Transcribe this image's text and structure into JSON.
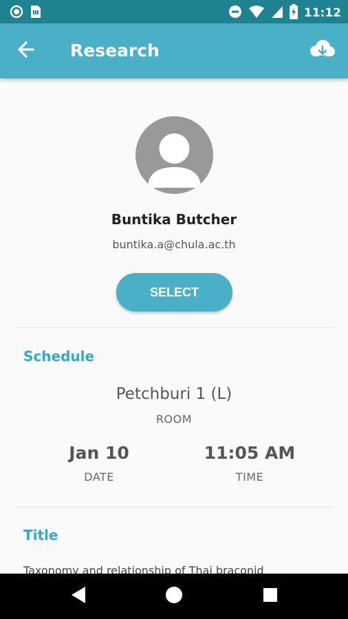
{
  "status_bar": {
    "time": "11:12",
    "icons": [
      "record-icon",
      "sim-card-icon",
      "do-not-disturb-icon",
      "wifi-icon",
      "signal-icon",
      "battery-charging-icon"
    ]
  },
  "app_bar": {
    "title": "Research",
    "back_icon": "arrow-back-icon",
    "action_icon": "cloud-download-icon"
  },
  "profile": {
    "name": "Buntika Butcher",
    "email": "buntika.a@chula.ac.th",
    "select_label": "SELECT"
  },
  "schedule": {
    "heading": "Schedule",
    "room_value": "Petchburi 1 (L)",
    "room_label": "ROOM",
    "date_value": "Jan 10",
    "date_label": "DATE",
    "time_value": "11:05 AM",
    "time_label": "TIME"
  },
  "title_section": {
    "heading": "Title",
    "text": "Taxonomy and relationship of Thai braconid"
  },
  "nav_bar": {
    "icons": [
      "back-triangle-icon",
      "home-circle-icon",
      "recents-square-icon"
    ]
  },
  "colors": {
    "status_bar": "#1f8290",
    "app_bar": "#4ab0c8",
    "accent": "#3aa8c2",
    "avatar_bg": "#999999"
  }
}
